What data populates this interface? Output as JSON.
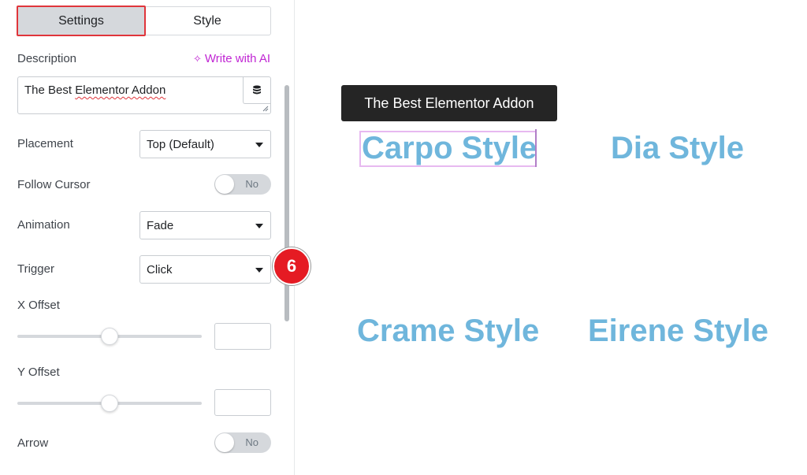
{
  "tabs": {
    "settings": "Settings",
    "style": "Style"
  },
  "description": {
    "label": "Description",
    "write_ai": "Write with AI",
    "value_prefix": "The Best ",
    "value_underlined": "Elementor Addon"
  },
  "placement": {
    "label": "Placement",
    "value": "Top (Default)"
  },
  "follow_cursor": {
    "label": "Follow Cursor",
    "value": "No"
  },
  "animation": {
    "label": "Animation",
    "value": "Fade"
  },
  "trigger": {
    "label": "Trigger",
    "value": "Click"
  },
  "x_offset": {
    "label": "X Offset"
  },
  "y_offset": {
    "label": "Y Offset"
  },
  "arrow": {
    "label": "Arrow",
    "value": "No"
  },
  "badge": "6",
  "preview": {
    "tooltip": "The Best Elementor Addon",
    "items": [
      "Carpo Style",
      "Dia Style",
      "Crame Style",
      "Eirene Style"
    ]
  },
  "colors": {
    "accent_pink": "#c026d3",
    "style_text": "#6fb6dc",
    "badge_red": "#e51b23",
    "highlight_red": "#e0353b"
  }
}
